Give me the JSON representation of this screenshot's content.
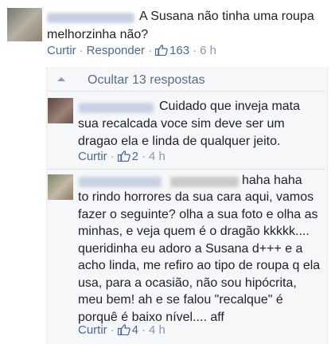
{
  "comment": {
    "text_line1": "A Susana não tinha uma roupa",
    "text_line2": "melhorzinha não?",
    "reply_label": "Curtir",
    "respond_label": "Responder",
    "likes": "163",
    "time": "6 h"
  },
  "replies_toggle": {
    "label": "Ocultar 13 respostas"
  },
  "reply1": {
    "lines": [
      "Cuidado que inveja mata",
      "sua recalcada voce sim deve ser um",
      "dragao ela e linda de qualquer jeito."
    ],
    "like_label": "Curtir",
    "likes": "2",
    "time": "4 h"
  },
  "reply2": {
    "line1": "haha haha",
    "lines": [
      "to rindo horrores da sua cara aqui, vamos",
      "fazer o seguinte? olha a sua foto e olha as",
      "minhas, e veja quem é o dragão kkkkk....",
      "queridinha eu adoro a Susana d+++ e a",
      "acho linda, me refiro ao tipo de roupa q ela",
      "usa, para a ocasião, não sou hipócrita,",
      "meu bem! ah e se falou \"recalque\" é",
      "porquê é baixo nível.... aff"
    ],
    "like_label": "Curtir",
    "likes": "4",
    "time": "4 h"
  },
  "colors": {
    "link": "#4b67a1",
    "meta": "#8b97b1",
    "reply_bg": "#f6f7f9"
  }
}
